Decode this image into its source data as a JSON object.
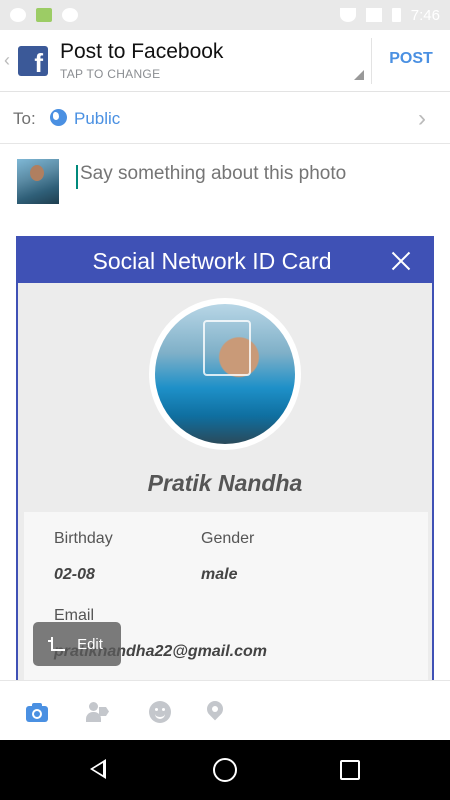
{
  "status_bar": {
    "time": "7:46",
    "icons": [
      "whatsapp-icon",
      "send-icon",
      "notification-icon",
      "wifi-icon",
      "signal-icon",
      "battery-icon"
    ]
  },
  "header": {
    "title": "Post to Facebook",
    "subtitle": "TAP TO CHANGE",
    "post_label": "POST"
  },
  "audience": {
    "to_label": "To:",
    "value": "Public"
  },
  "composer": {
    "placeholder": "Say something about this photo"
  },
  "card": {
    "title": "Social Network ID Card",
    "name": "Pratik Nandha",
    "birthday_label": "Birthday",
    "birthday_value": "02-08",
    "gender_label": "Gender",
    "gender_value": "male",
    "email_label": "Email",
    "email_value": "pratiknandha22@gmail.com"
  },
  "edit_chip": {
    "label": "Edit"
  },
  "actions": [
    "camera-icon",
    "tag-people-icon",
    "feeling-icon",
    "location-icon"
  ],
  "colors": {
    "facebook_blue": "#3b5998",
    "accent_blue": "#4a90e2",
    "card_header": "#3f51b5"
  }
}
